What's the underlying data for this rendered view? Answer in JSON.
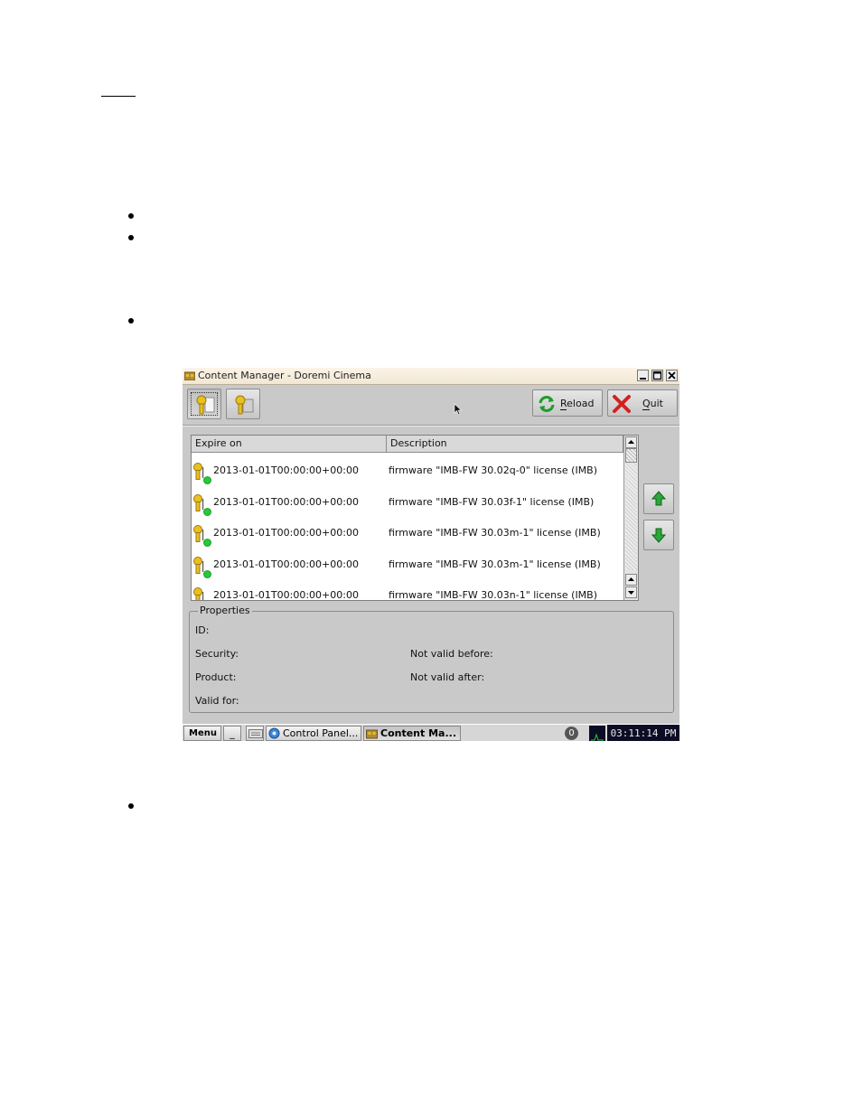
{
  "window": {
    "title": "Content Manager - Doremi Cinema"
  },
  "toolbar": {
    "reload_label": "Reload",
    "reload_mnemonic": "R",
    "quit_label": "Quit",
    "quit_mnemonic": "Q"
  },
  "table": {
    "columns": [
      "Expire on",
      "Description"
    ],
    "rows": [
      {
        "expire": "2013-01-01T00:00:00+00:00",
        "description": "firmware \"IMB-FW  30.02q-0\" license (IMB)"
      },
      {
        "expire": "2013-01-01T00:00:00+00:00",
        "description": "firmware \"IMB-FW  30.03f-1\" license (IMB)"
      },
      {
        "expire": "2013-01-01T00:00:00+00:00",
        "description": "firmware \"IMB-FW  30.03m-1\" license (IMB)"
      },
      {
        "expire": "2013-01-01T00:00:00+00:00",
        "description": "firmware \"IMB-FW  30.03m-1\" license (IMB)"
      },
      {
        "expire": "2013-01-01T00:00:00+00:00",
        "description": "firmware \"IMB-FW  30.03n-1\" license (IMB)"
      }
    ]
  },
  "properties": {
    "title": "Properties",
    "id_label": "ID:",
    "security_label": "Security:",
    "product_label": "Product:",
    "valid_for_label": "Valid for:",
    "not_valid_before_label": "Not valid before:",
    "not_valid_after_label": "Not valid after:"
  },
  "taskbar": {
    "menu_label": "Menu",
    "minimize_label": "_",
    "items": [
      "Control Panel...",
      "Content Ma..."
    ],
    "tray_icon": "0",
    "clock": "03:11:14 PM"
  },
  "colors": {
    "window_bg": "#c9c9c9",
    "titlebar_bg": "#f3ead8",
    "status_green": "#22cc33",
    "key_yellow": "#e8c020",
    "clock_bg": "#0c0c24"
  },
  "icons": {
    "license_key": "key-icon",
    "status": "green-dot-icon",
    "reload": "reload-icon",
    "quit": "red-x-icon",
    "move_up": "green-up-arrow-icon",
    "move_down": "green-down-arrow-icon"
  }
}
